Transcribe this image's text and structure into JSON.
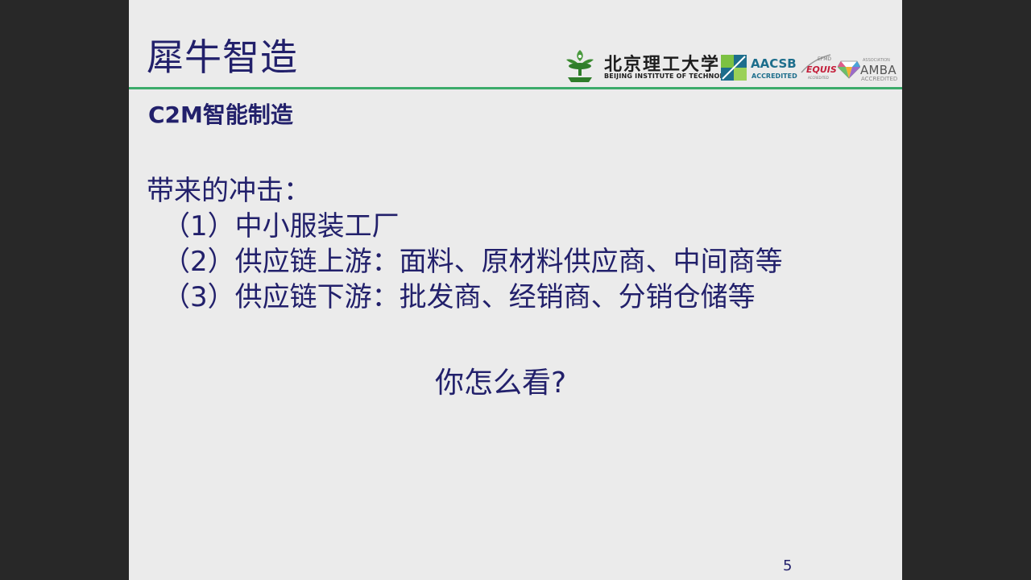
{
  "slide": {
    "title": "犀牛智造",
    "subtitle": "C2M智能制造",
    "body": {
      "heading": "带来的冲击：",
      "items": [
        "（1）中小服装工厂",
        "（2）供应链上游：面料、原材料供应商、中间商等",
        "（3）供应链下游：批发商、经销商、分销仓储等"
      ]
    },
    "question": "你怎么看?",
    "page_number": "5"
  },
  "logos": {
    "bit_cn": "北京理工大学",
    "bit_en": "BEIJING INSTITUTE OF TECHNOLOGY",
    "aacsb": "AACSB",
    "aacsb_sub": "ACCREDITED",
    "efmd": "EFMD",
    "equis": "EQUIS",
    "equis_sub": "ACCREDITED",
    "amba_assoc": "ASSOCIATION",
    "amba": "AMBA",
    "amba_sub": "ACCREDITED"
  },
  "colors": {
    "text_primary": "#22206b",
    "rule": "#3cab6a",
    "slide_bg": "#ebebeb",
    "pillarbox": "#282828"
  },
  "icons": [
    "bit-emblem-icon",
    "aacsb-logo-icon",
    "equis-swoosh-icon",
    "amba-diamond-icon"
  ]
}
